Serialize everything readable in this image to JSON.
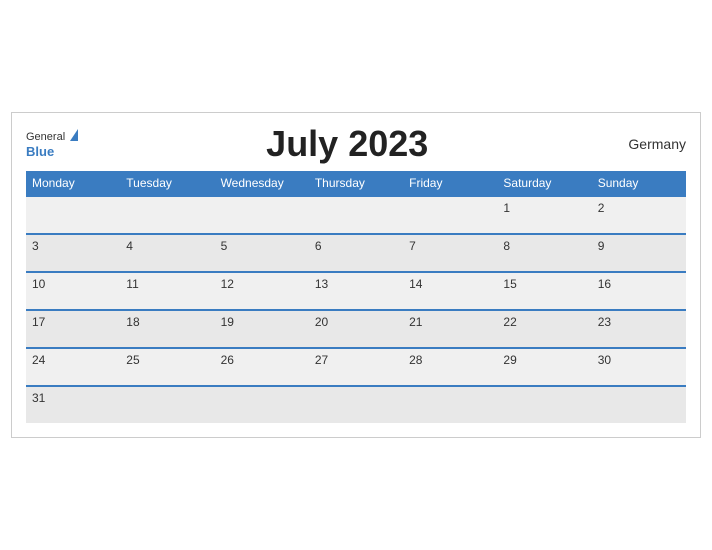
{
  "header": {
    "logo_general": "General",
    "logo_blue": "Blue",
    "title": "July 2023",
    "country": "Germany"
  },
  "weekdays": [
    "Monday",
    "Tuesday",
    "Wednesday",
    "Thursday",
    "Friday",
    "Saturday",
    "Sunday"
  ],
  "weeks": [
    [
      "",
      "",
      "",
      "",
      "",
      "1",
      "2"
    ],
    [
      "3",
      "4",
      "5",
      "6",
      "7",
      "8",
      "9"
    ],
    [
      "10",
      "11",
      "12",
      "13",
      "14",
      "15",
      "16"
    ],
    [
      "17",
      "18",
      "19",
      "20",
      "21",
      "22",
      "23"
    ],
    [
      "24",
      "25",
      "26",
      "27",
      "28",
      "29",
      "30"
    ],
    [
      "31",
      "",
      "",
      "",
      "",
      "",
      ""
    ]
  ]
}
